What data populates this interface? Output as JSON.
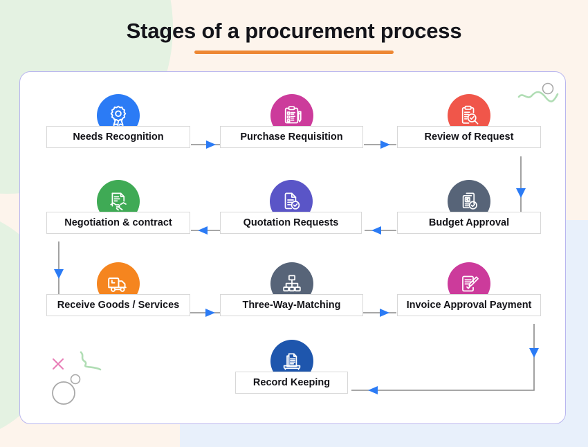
{
  "header": {
    "title": "Stages of a procurement process",
    "underline_color": "#ed8733"
  },
  "canvas": {
    "background_color": "#fdf4ec",
    "panel_right_color": "#e8f0fb",
    "blob_color": "#e4f2e2",
    "card_background": "#ffffff",
    "card_border_color": "#b9b6ef"
  },
  "diagram": {
    "type": "flowchart",
    "connector_line_color": "#8a8a8a",
    "arrowhead_color": "#2b7bf5",
    "nodes": [
      {
        "id": "needs-recognition",
        "label": "Needs Recognition",
        "icon": "award-ribbon-icon",
        "color": "#2b7bf5",
        "row": 1,
        "col": 1
      },
      {
        "id": "purchase-requisition",
        "label": "Purchase Requisition",
        "icon": "clipboard-pencil-icon",
        "color": "#cc3b9b",
        "row": 1,
        "col": 2
      },
      {
        "id": "review-of-request",
        "label": "Review of Request",
        "icon": "clipboard-search-icon",
        "color": "#f0564a",
        "row": 1,
        "col": 3
      },
      {
        "id": "negotiation-contract",
        "label": "Negotiation & contract",
        "icon": "contract-handshake-icon",
        "color": "#3faa55",
        "row": 2,
        "col": 1
      },
      {
        "id": "quotation-requests",
        "label": "Quotation Requests",
        "icon": "document-check-icon",
        "color": "#5a55c7",
        "row": 2,
        "col": 2
      },
      {
        "id": "budget-approval",
        "label": "Budget Approval",
        "icon": "money-document-icon",
        "color": "#576478",
        "row": 2,
        "col": 3
      },
      {
        "id": "receive-goods",
        "label": "Receive Goods / Services",
        "icon": "delivery-truck-icon",
        "color": "#f5851f",
        "row": 3,
        "col": 1
      },
      {
        "id": "three-way-matching",
        "label": "Three-Way-Matching",
        "icon": "hierarchy-icon",
        "color": "#576478",
        "row": 3,
        "col": 2
      },
      {
        "id": "invoice-approval",
        "label": "Invoice Approval Payment",
        "icon": "invoice-pen-icon",
        "color": "#cc3b9b",
        "row": 3,
        "col": 3
      },
      {
        "id": "record-keeping",
        "label": "Record Keeping",
        "icon": "archive-documents-icon",
        "color": "#1e56ad",
        "row": 4,
        "col": 2
      }
    ],
    "flow_order": [
      "Needs Recognition",
      "Purchase Requisition",
      "Review of Request",
      "Budget Approval",
      "Quotation Requests",
      "Negotiation & contract",
      "Receive Goods / Services",
      "Three-Way-Matching",
      "Invoice Approval Payment",
      "Record Keeping"
    ]
  },
  "decorations": {
    "cross_color": "#e87bb5",
    "squiggle_color": "#b0ddb4",
    "circle_color": "#a9a9a9"
  }
}
